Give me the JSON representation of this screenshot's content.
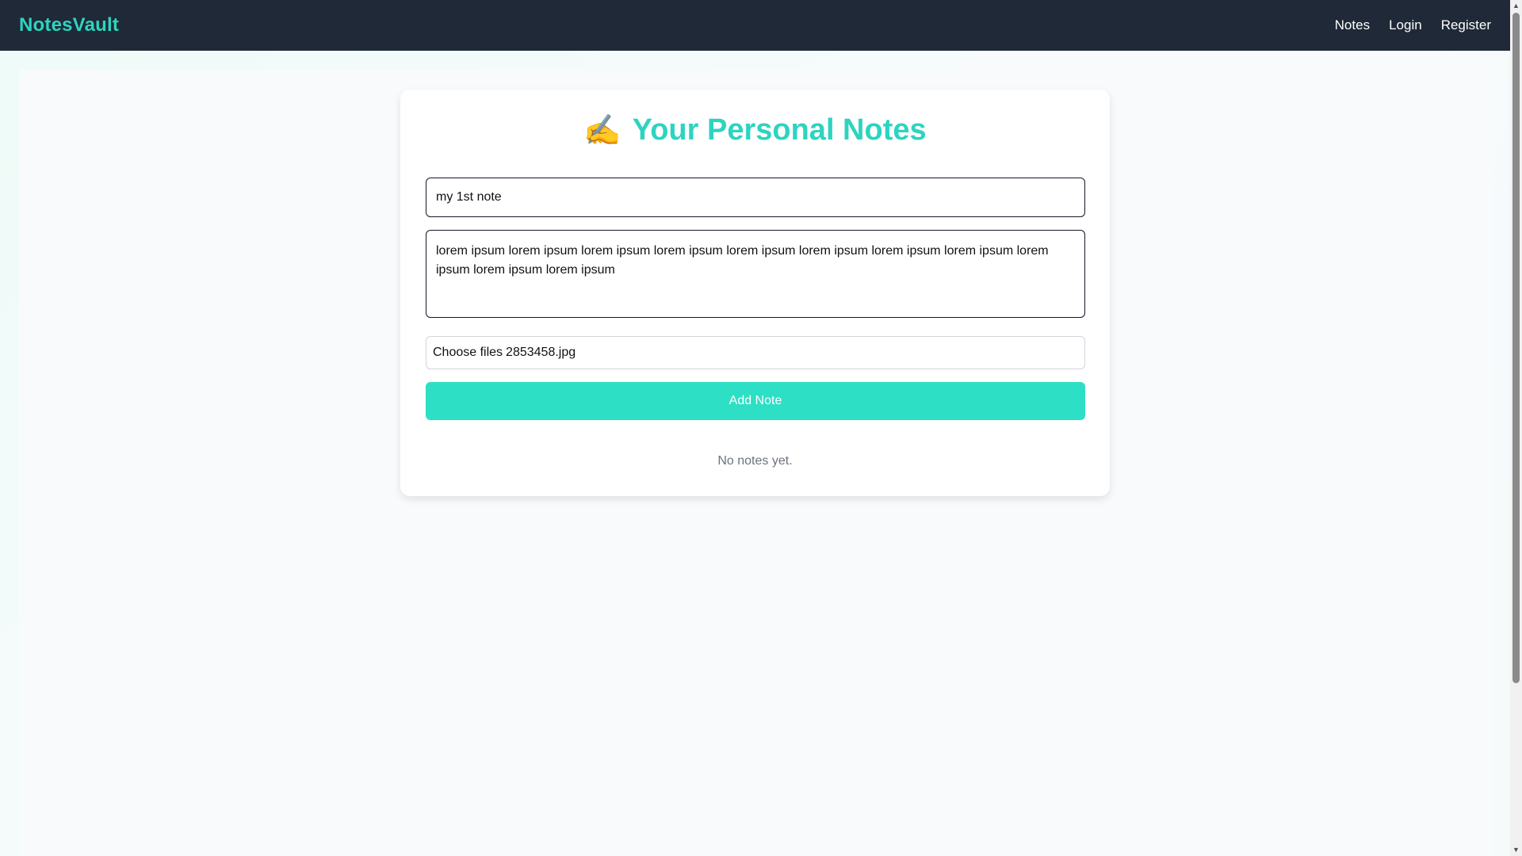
{
  "navbar": {
    "brand": "NotesVault",
    "links": [
      {
        "label": "Notes"
      },
      {
        "label": "Login"
      },
      {
        "label": "Register"
      }
    ],
    "background": "#1f2937",
    "brand_color": "#2dd4bf"
  },
  "main": {
    "title_emoji": "✍️",
    "title": "Your Personal Notes",
    "title_input_value": "my 1st note",
    "body_textarea_value": "lorem ipsum lorem ipsum lorem ipsum lorem ipsum lorem ipsum lorem ipsum lorem ipsum lorem ipsum lorem ipsum lorem ipsum lorem ipsum",
    "file_button_label": "Choose files",
    "file_name": "2853458.jpg",
    "add_button_label": "Add Note",
    "empty_message": "No notes yet.",
    "accent_color": "#2ddfc4"
  },
  "scrollbar": {
    "up_icon": "arrow-up-icon",
    "down_icon": "arrow-down-icon"
  }
}
